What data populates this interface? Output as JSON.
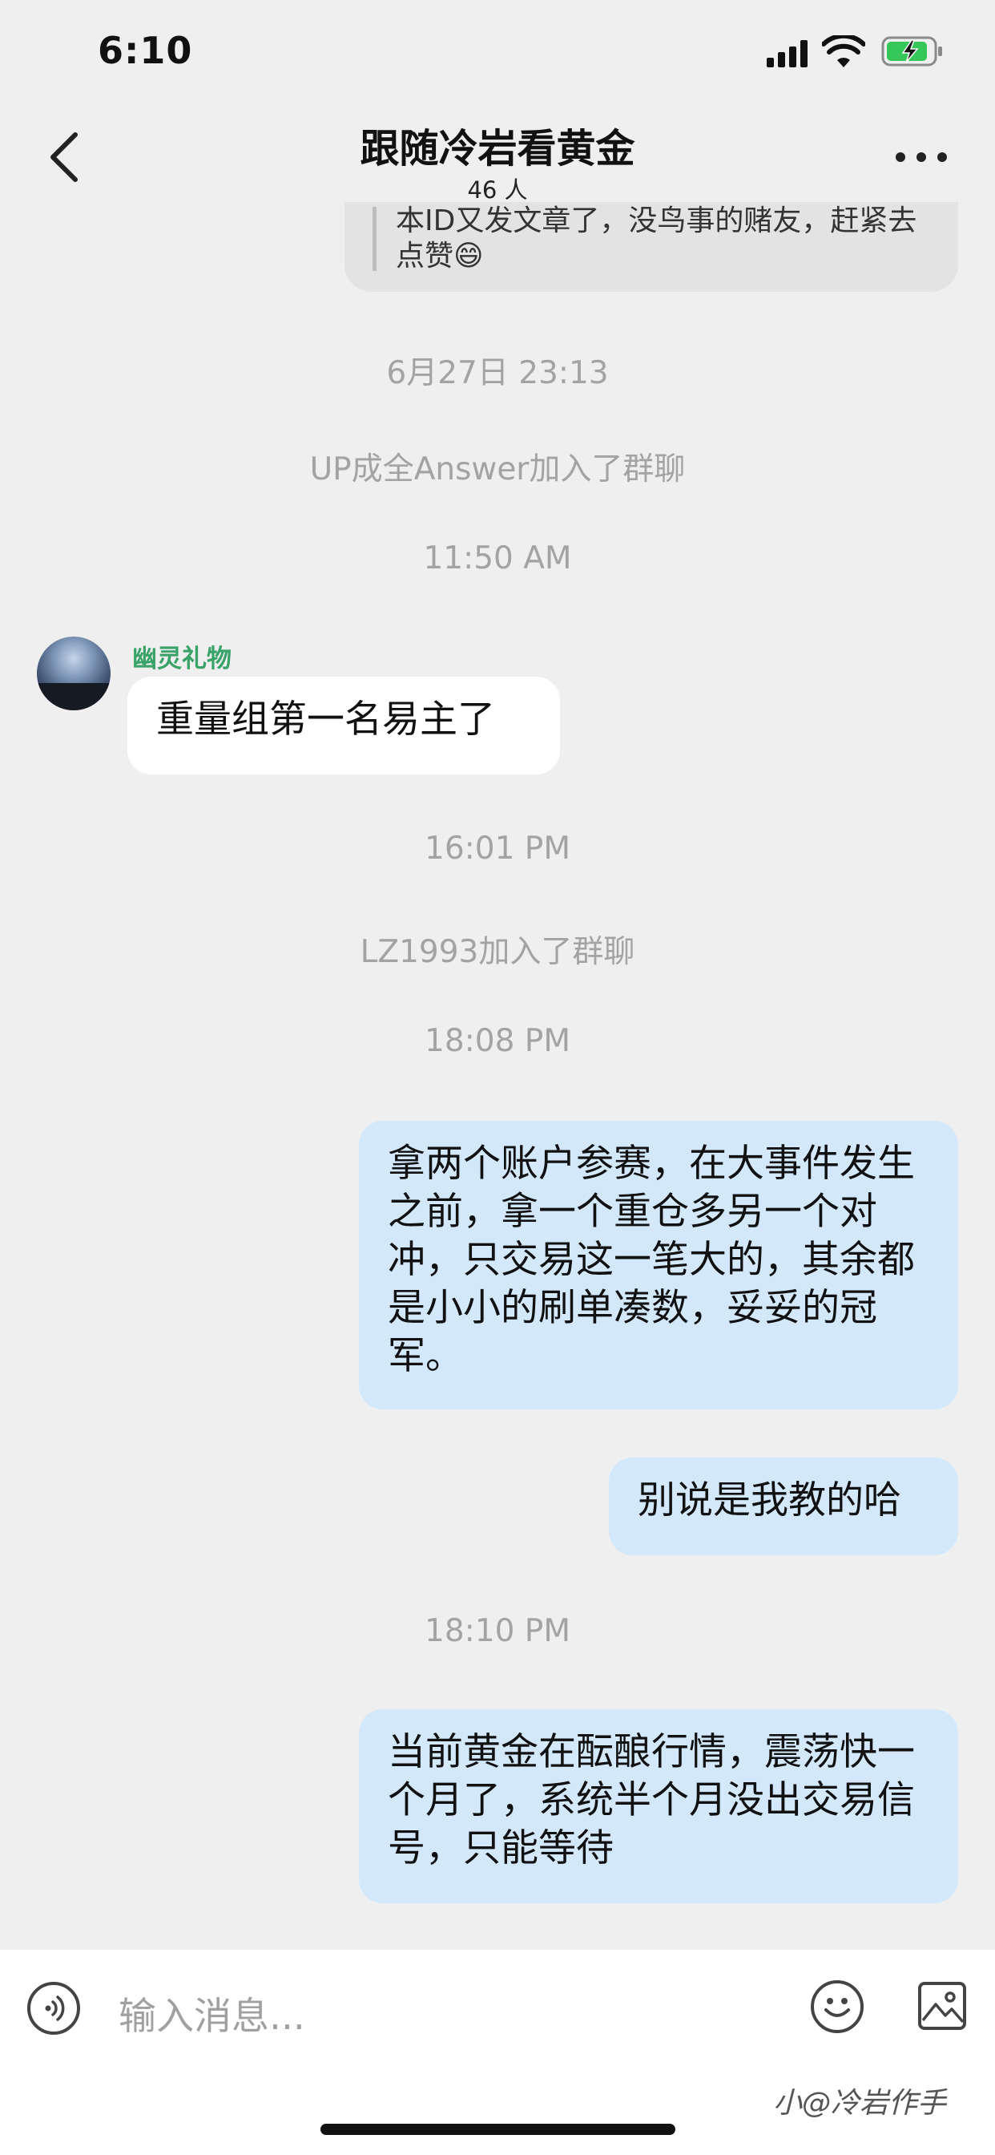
{
  "status_bar": {
    "time": "6:10"
  },
  "header": {
    "title": "跟随冷岩看黄金",
    "member_count": "46 人"
  },
  "top_message": {
    "text": "本ID又发文章了，没鸟事的赌友，赶紧去点赞😄"
  },
  "timeline": {
    "time_1": "6月27日 23:13",
    "system_1": "UP成全Answer加入了群聊",
    "time_2": "11:50 AM",
    "incoming_sender": "幽灵礼物",
    "incoming_text": "重量组第一名易主了",
    "time_3": "16:01 PM",
    "system_2": "LZ1993加入了群聊",
    "time_4": "18:08 PM",
    "outgoing_1": "拿两个账户参赛，在大事件发生之前，拿一个重仓多另一个对冲，只交易这一笔大的，其余都是小小的刷单凑数，妥妥的冠军。",
    "outgoing_2": "别说是我教的哈",
    "time_5": "18:10 PM",
    "outgoing_3": "当前黄金在酝酿行情，震荡快一个月了，系统半个月没出交易信号，只能等待"
  },
  "input": {
    "placeholder": "输入消息..."
  },
  "watermark": "小@冷岩作手",
  "icons": [
    "back-icon",
    "more-icon",
    "voice-icon",
    "emoji-icon",
    "image-icon",
    "signal-icon",
    "wifi-icon",
    "battery-icon"
  ],
  "colors": {
    "background": "#efefef",
    "outgoing_bubble": "#d4e8fb",
    "incoming_bubble": "#ffffff",
    "sender_name": "#38a268"
  }
}
